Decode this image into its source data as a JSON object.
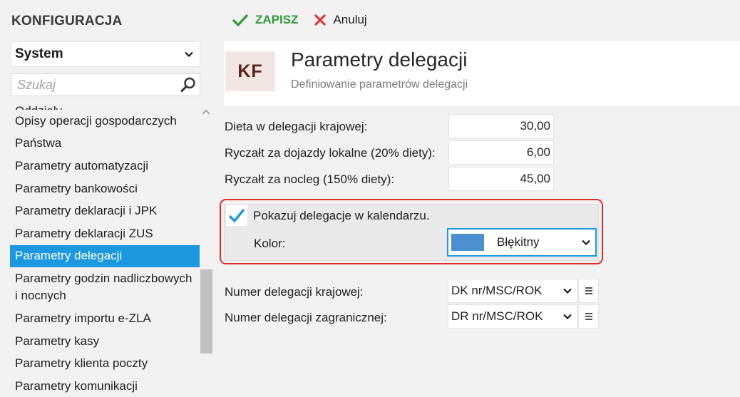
{
  "sidebar": {
    "title": "KONFIGURACJA",
    "section_select": "System",
    "search_placeholder": "Szukaj",
    "items": [
      {
        "label": "Oddziały"
      },
      {
        "label": "Opisy operacji gospodarczych"
      },
      {
        "label": "Państwa"
      },
      {
        "label": "Parametry automatyzacji"
      },
      {
        "label": "Parametry bankowości"
      },
      {
        "label": "Parametry deklaracji i JPK"
      },
      {
        "label": "Parametry deklaracji ZUS"
      },
      {
        "label": "Parametry delegacji"
      },
      {
        "label": "Parametry godzin nadliczbowych i nocnych"
      },
      {
        "label": "Parametry importu e-ZLA"
      },
      {
        "label": "Parametry kasy"
      },
      {
        "label": "Parametry klienta poczty"
      },
      {
        "label": "Parametry komunikacji"
      }
    ]
  },
  "toolbar": {
    "save_label": "ZAPISZ",
    "cancel_label": "Anuluj"
  },
  "header": {
    "logo": "KF",
    "title": "Parametry delegacji",
    "subtitle": "Definiowanie parametrów delegacji"
  },
  "form": {
    "diet_domestic_label": "Dieta w delegacji krajowej:",
    "diet_domestic_value": "30,00",
    "local_commute_label": "Ryczałt za dojazdy lokalne (20% diety):",
    "local_commute_value": "6,00",
    "overnight_label": "Ryczałt za nocleg (150% diety):",
    "overnight_value": "45,00",
    "show_in_calendar_label": "Pokazuj delegacje w kalendarzu.",
    "show_in_calendar_checked": true,
    "color_label": "Kolor:",
    "color_value": "Błękitny",
    "color_swatch": "#4a8fcf",
    "number_domestic_label": "Numer delegacji krajowej:",
    "number_domestic_value": "DK nr/MSC/ROK",
    "number_foreign_label": "Numer delegacji zagranicznej:",
    "number_foreign_value": "DR nr/MSC/ROK"
  },
  "colors": {
    "accent": "#1b98e0",
    "save": "#2f9a35",
    "cancel": "#e02b2b",
    "highlight_border": "#e02b2b"
  }
}
